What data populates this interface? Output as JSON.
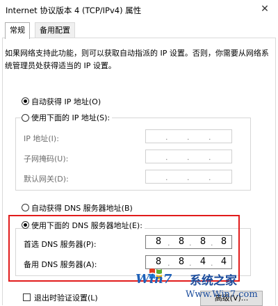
{
  "window": {
    "title": "Internet 协议版本 4 (TCP/IPv4) 属性",
    "close_glyph": "✕"
  },
  "tabs": [
    {
      "label": "常规"
    },
    {
      "label": "备用配置"
    }
  ],
  "description": "如果网络支持此功能，则可以获取自动指派的 IP 设置。否则，你需要从网络系统管理员处获得适当的 IP 设置。",
  "ip_settings": {
    "auto_label": "自动获得 IP 地址(O)",
    "manual_label": "使用下面的 IP 地址(S):",
    "selected": "auto",
    "fields": [
      {
        "label": "IP 地址(I):",
        "octets": [
          "",
          "",
          "",
          ""
        ]
      },
      {
        "label": "子网掩码(U):",
        "octets": [
          "",
          "",
          "",
          ""
        ]
      },
      {
        "label": "默认网关(D):",
        "octets": [
          "",
          "",
          "",
          ""
        ]
      }
    ]
  },
  "dns_settings": {
    "auto_label": "自动获得 DNS 服务器地址(B)",
    "manual_label": "使用下面的 DNS 服务器地址(E):",
    "selected": "manual",
    "fields": [
      {
        "label": "首选 DNS 服务器(P):",
        "octets": [
          "8",
          "8",
          "8",
          "8"
        ]
      },
      {
        "label": "备用 DNS 服务器(A):",
        "octets": [
          "8",
          "8",
          "4",
          "4"
        ]
      }
    ]
  },
  "validate_on_exit_label": "退出时验证设置(L)",
  "advanced_button_label": "高级(V)...",
  "watermark": {
    "text": "系统之家",
    "url": "Www.Win7.com",
    "logo": "Win7"
  },
  "colors": {
    "highlight": "#e11b1b"
  }
}
